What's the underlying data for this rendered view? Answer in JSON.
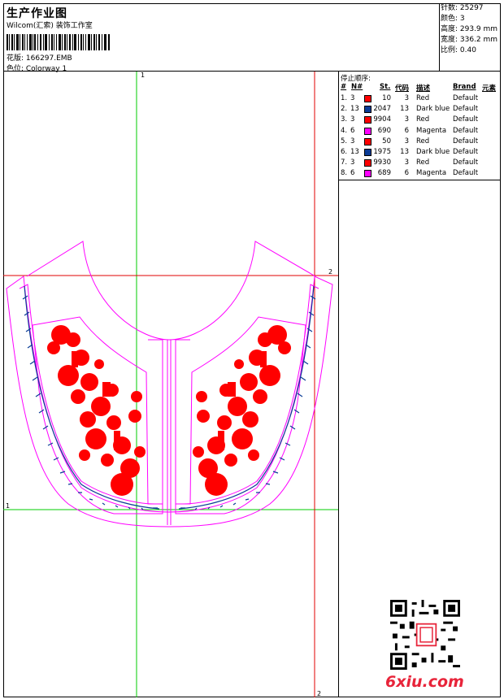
{
  "header": {
    "title": "生产作业图",
    "subtitle": "Wilcom(汇索) 装饰工作室",
    "design_label": "花版: 166297.EMB",
    "colorway_label": "色位: Colorway 1"
  },
  "info": {
    "stitches": "针数: 25297",
    "colors": "颜色: 3",
    "height": "高度: 293.9 mm",
    "width": "宽度: 336.2 mm",
    "scale": "比例: 0.40"
  },
  "stop_sequence": {
    "title": "停止顺序:",
    "columns": [
      "#",
      "N#",
      "St.",
      "代码",
      "描述",
      "Brand",
      "元素"
    ],
    "rows": [
      {
        "idx": "1.",
        "n": "3",
        "color": "#ff0000",
        "st": "10",
        "code": "3",
        "desc": "Red",
        "brand": "Default"
      },
      {
        "idx": "2.",
        "n": "13",
        "color": "#0b3c96",
        "st": "2047",
        "code": "13",
        "desc": "Dark blue",
        "brand": "Default"
      },
      {
        "idx": "3.",
        "n": "3",
        "color": "#ff0000",
        "st": "9904",
        "code": "3",
        "desc": "Red",
        "brand": "Default"
      },
      {
        "idx": "4.",
        "n": "6",
        "color": "#ff00ff",
        "st": "690",
        "code": "6",
        "desc": "Magenta",
        "brand": "Default"
      },
      {
        "idx": "5.",
        "n": "3",
        "color": "#ff0000",
        "st": "50",
        "code": "3",
        "desc": "Red",
        "brand": "Default"
      },
      {
        "idx": "6.",
        "n": "13",
        "color": "#0b3c96",
        "st": "1975",
        "code": "13",
        "desc": "Dark blue",
        "brand": "Default"
      },
      {
        "idx": "7.",
        "n": "3",
        "color": "#ff0000",
        "st": "9930",
        "code": "3",
        "desc": "Red",
        "brand": "Default"
      },
      {
        "idx": "8.",
        "n": "6",
        "color": "#ff00ff",
        "st": "689",
        "code": "6",
        "desc": "Magenta",
        "brand": "Default"
      }
    ]
  },
  "guides": {
    "green_top": "1",
    "green_left": "1",
    "red_right": "2",
    "red_bottom": "2"
  },
  "watermark": "6xiu.com",
  "colors": {
    "red": "#ff0000",
    "magenta": "#ff00ff",
    "green": "#00cc00",
    "blue": "#0b3c96"
  }
}
